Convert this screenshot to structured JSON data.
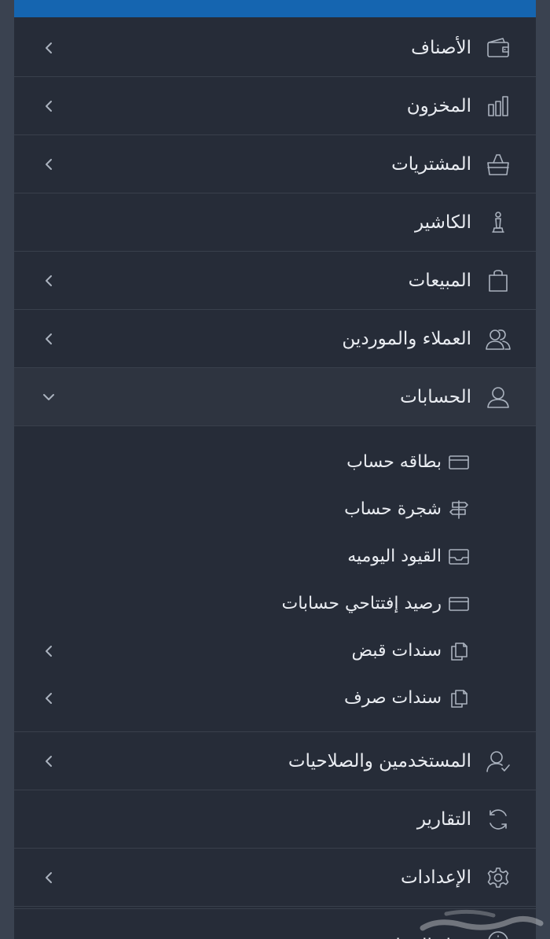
{
  "menu": {
    "items": [
      {
        "label": "الأصناف",
        "icon": "wallet-icon",
        "has_submenu": true
      },
      {
        "label": "المخزون",
        "icon": "inventory-bars-icon",
        "has_submenu": true
      },
      {
        "label": "المشتريات",
        "icon": "shopping-basket-icon",
        "has_submenu": true
      },
      {
        "label": "الكاشير",
        "icon": "chess-piece-icon",
        "has_submenu": false
      },
      {
        "label": "المبيعات",
        "icon": "shopping-bag-icon",
        "has_submenu": true
      },
      {
        "label": "العملاء والموردين",
        "icon": "users-icon",
        "has_submenu": true
      },
      {
        "label": "الحسابات",
        "icon": "user-icon",
        "has_submenu": true,
        "expanded": true
      },
      {
        "label": "المستخدمين والصلاحيات",
        "icon": "user-check-icon",
        "has_submenu": true
      },
      {
        "label": "التقارير",
        "icon": "refresh-icon",
        "has_submenu": false
      },
      {
        "label": "الإعدادات",
        "icon": "gear-icon",
        "has_submenu": true
      },
      {
        "label": "حول البرنامج",
        "icon": "info-icon",
        "has_submenu": false
      }
    ],
    "accounts_submenu": [
      {
        "label": "بطاقه حساب",
        "icon": "card-icon",
        "has_submenu": false
      },
      {
        "label": "شجرة حساب",
        "icon": "signpost-icon",
        "has_submenu": false
      },
      {
        "label": "القيود اليوميه",
        "icon": "inbox-icon",
        "has_submenu": false
      },
      {
        "label": "رصيد إفتتاحي حسابات",
        "icon": "card-icon",
        "has_submenu": false
      },
      {
        "label": "سندات قبض",
        "icon": "documents-icon",
        "has_submenu": true
      },
      {
        "label": "سندات صرف",
        "icon": "documents-icon",
        "has_submenu": true
      }
    ]
  },
  "watermark": {
    "text": "حراج"
  },
  "colors": {
    "panel_bg": "#262c38",
    "page_bg": "#3a4250",
    "accent_bar": "#1565b0",
    "text": "#e9ecf1",
    "icon": "#aab2be"
  }
}
